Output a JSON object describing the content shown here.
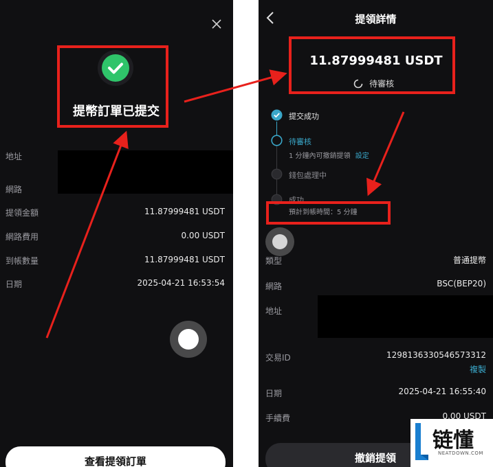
{
  "left": {
    "success_title": "提幣訂單已提交",
    "rows": [
      {
        "label": "地址",
        "value": ""
      },
      {
        "label": "網路",
        "value": ""
      },
      {
        "label": "提領金額",
        "value": "11.87999481 USDT"
      },
      {
        "label": "網路費用",
        "value": "0.00 USDT"
      },
      {
        "label": "到帳數量",
        "value": "11.87999481 USDT"
      },
      {
        "label": "日期",
        "value": "2025-04-21 16:53:54"
      }
    ],
    "view_order_button": "查看提領訂單"
  },
  "right": {
    "header_title": "提領詳情",
    "amount": "11.87999481 USDT",
    "status": "待審核",
    "timeline": [
      {
        "title": "提交成功",
        "state": "done"
      },
      {
        "title": "待審核",
        "state": "current",
        "note": "1 分鐘內可撤銷提領",
        "link": "設定"
      },
      {
        "title": "錢包處理中",
        "state": "pending"
      },
      {
        "title": "成功",
        "state": "pending"
      }
    ],
    "eta": "預計到帳時間：5 分鐘",
    "details": {
      "type_label": "類型",
      "type_value": "普通提幣",
      "network_label": "網路",
      "network_value": "BSC(BEP20)",
      "address_label": "地址",
      "txid_label": "交易ID",
      "txid_value": "1298136330546573312",
      "copy_link": "複製",
      "date_label": "日期",
      "date_value": "2025-04-21 16:55:40",
      "fee_label": "手續費",
      "fee_value": "0.00 USDT"
    },
    "cancel_button": "撤銷提領"
  },
  "watermark": {
    "brand": "链懂",
    "site": "NEATDOWN.COM"
  },
  "colors": {
    "annotation": "#e8211c",
    "success": "#2fc46a",
    "accent": "#3aa7c9",
    "bg": "#101012"
  }
}
